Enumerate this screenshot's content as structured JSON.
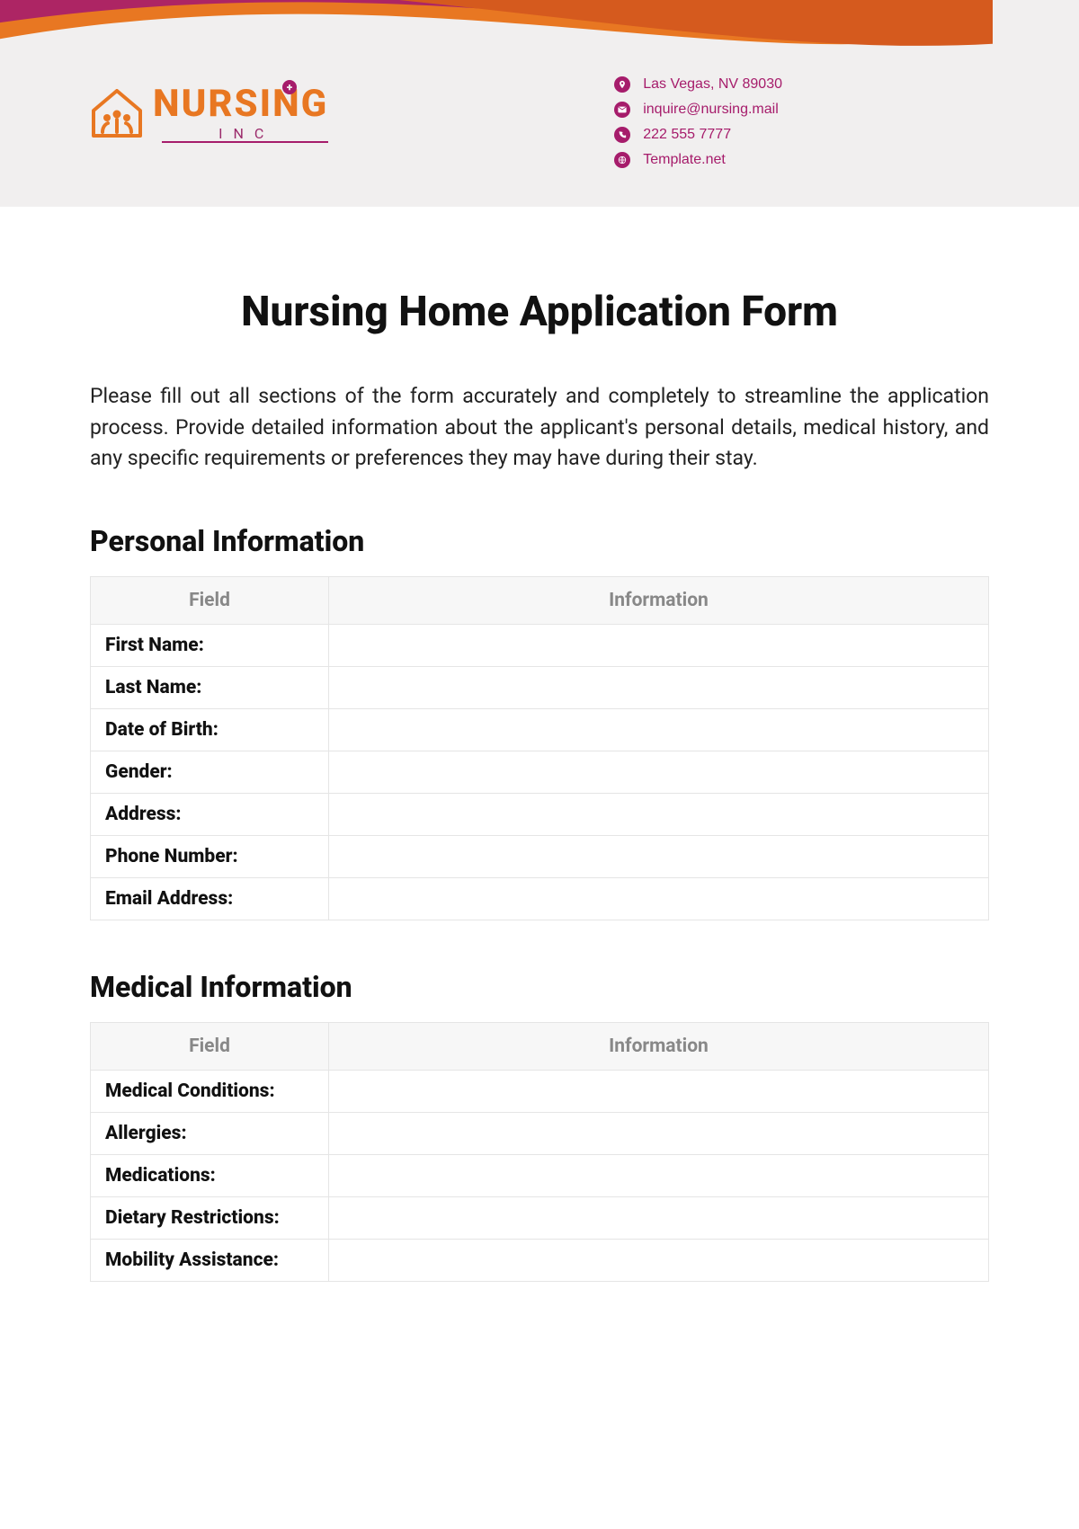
{
  "company": {
    "name": "NURSING",
    "subline": "INC"
  },
  "contact": {
    "address": "Las Vegas, NV 89030",
    "email": "inquire@nursing.mail",
    "phone": "222 555 7777",
    "website": "Template.net"
  },
  "title": "Nursing Home Application Form",
  "instructions": "Please fill out all sections of the form accurately and completely to streamline the application process. Provide detailed information about the applicant's personal details, medical history, and any specific requirements or preferences they may have during their stay.",
  "table_headers": {
    "field": "Field",
    "information": "Information"
  },
  "sections": {
    "personal": {
      "heading": "Personal Information",
      "rows": [
        {
          "label": "First Name:",
          "value": ""
        },
        {
          "label": "Last Name:",
          "value": ""
        },
        {
          "label": "Date of Birth:",
          "value": ""
        },
        {
          "label": "Gender:",
          "value": ""
        },
        {
          "label": "Address:",
          "value": ""
        },
        {
          "label": "Phone Number:",
          "value": ""
        },
        {
          "label": "Email Address:",
          "value": ""
        }
      ]
    },
    "medical": {
      "heading": "Medical Information",
      "rows": [
        {
          "label": "Medical Conditions:",
          "value": ""
        },
        {
          "label": "Allergies:",
          "value": ""
        },
        {
          "label": "Medications:",
          "value": ""
        },
        {
          "label": "Dietary Restrictions:",
          "value": ""
        },
        {
          "label": "Mobility Assistance:",
          "value": ""
        }
      ]
    }
  }
}
